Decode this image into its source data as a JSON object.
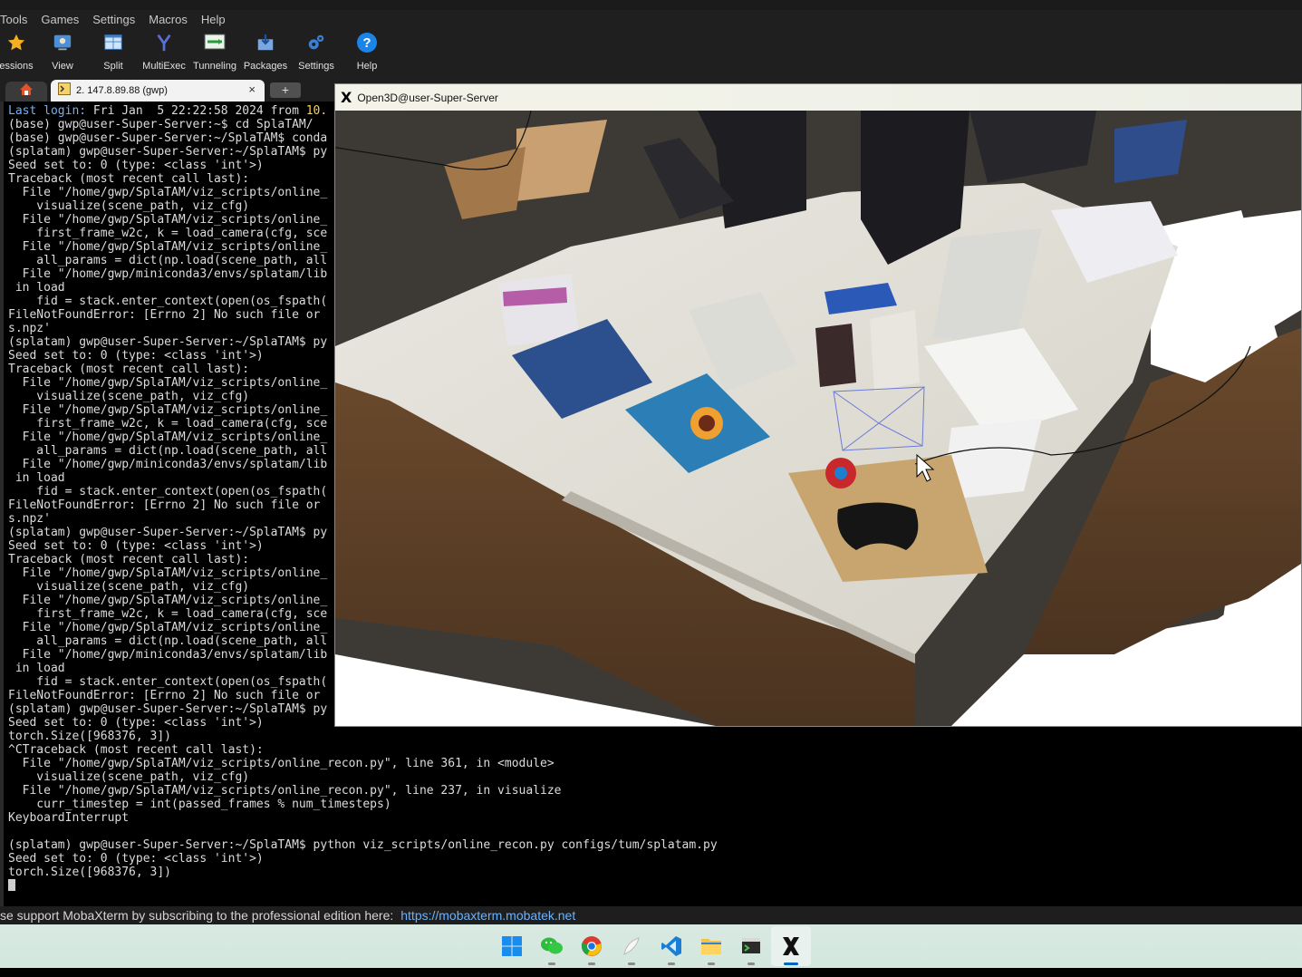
{
  "menubar": {
    "items": [
      "Tools",
      "Games",
      "Settings",
      "Macros",
      "Help"
    ]
  },
  "toolbar": {
    "items": [
      {
        "label": "essions",
        "icon": "star-icon"
      },
      {
        "label": "View",
        "icon": "view-icon"
      },
      {
        "label": "Split",
        "icon": "split-icon"
      },
      {
        "label": "MultiExec",
        "icon": "multiexec-icon"
      },
      {
        "label": "Tunneling",
        "icon": "tunneling-icon"
      },
      {
        "label": "Packages",
        "icon": "packages-icon"
      },
      {
        "label": "Settings",
        "icon": "gears-icon"
      },
      {
        "label": "Help",
        "icon": "help-icon"
      }
    ]
  },
  "tabs": {
    "session_label": "2. 147.8.89.88 (gwp)",
    "close": "×",
    "new_tab": "+"
  },
  "terminal": {
    "lines": [
      [
        "Last login: Fri Jan  5 22:22:58 2024 from 10."
      ],
      [
        "(base) gwp@user-Super-Server:~$ cd SplaTAM/"
      ],
      [
        "(base) gwp@user-Super-Server:~/SplaTAM$ conda"
      ],
      [
        "(splatam) gwp@user-Super-Server:~/SplaTAM$ py"
      ],
      [
        "Seed set to: 0 (type: <class 'int'>)"
      ],
      [
        "Traceback (most recent call last):"
      ],
      [
        "  File \"/home/gwp/SplaTAM/viz_scripts/online_"
      ],
      [
        "    visualize(scene_path, viz_cfg)"
      ],
      [
        "  File \"/home/gwp/SplaTAM/viz_scripts/online_"
      ],
      [
        "    first_frame_w2c, k = load_camera(cfg, sce"
      ],
      [
        "  File \"/home/gwp/SplaTAM/viz_scripts/online_"
      ],
      [
        "    all_params = dict(np.load(scene_path, all"
      ],
      [
        "  File \"/home/gwp/miniconda3/envs/splatam/lib"
      ],
      [
        " in load"
      ],
      [
        "    fid = stack.enter_context(open(os_fspath("
      ],
      [
        "FileNotFoundError: [Errno 2] No such file or"
      ],
      [
        "s.npz'"
      ],
      [
        "(splatam) gwp@user-Super-Server:~/SplaTAM$ py"
      ],
      [
        "Seed set to: 0 (type: <class 'int'>)"
      ],
      [
        "Traceback (most recent call last):"
      ],
      [
        "  File \"/home/gwp/SplaTAM/viz_scripts/online_"
      ],
      [
        "    visualize(scene_path, viz_cfg)"
      ],
      [
        "  File \"/home/gwp/SplaTAM/viz_scripts/online_"
      ],
      [
        "    first_frame_w2c, k = load_camera(cfg, sce"
      ],
      [
        "  File \"/home/gwp/SplaTAM/viz_scripts/online_"
      ],
      [
        "    all_params = dict(np.load(scene_path, all"
      ],
      [
        "  File \"/home/gwp/miniconda3/envs/splatam/lib"
      ],
      [
        " in load"
      ],
      [
        "    fid = stack.enter_context(open(os_fspath("
      ],
      [
        "FileNotFoundError: [Errno 2] No such file or"
      ],
      [
        "s.npz'"
      ],
      [
        "(splatam) gwp@user-Super-Server:~/SplaTAM$ py"
      ],
      [
        "Seed set to: 0 (type: <class 'int'>)"
      ],
      [
        "Traceback (most recent call last):"
      ],
      [
        "  File \"/home/gwp/SplaTAM/viz_scripts/online_"
      ],
      [
        "    visualize(scene_path, viz_cfg)"
      ],
      [
        "  File \"/home/gwp/SplaTAM/viz_scripts/online_"
      ],
      [
        "    first_frame_w2c, k = load_camera(cfg, sce"
      ],
      [
        "  File \"/home/gwp/SplaTAM/viz_scripts/online_"
      ],
      [
        "    all_params = dict(np.load(scene_path, all"
      ],
      [
        "  File \"/home/gwp/miniconda3/envs/splatam/lib"
      ],
      [
        " in load"
      ],
      [
        "    fid = stack.enter_context(open(os_fspath("
      ],
      [
        "FileNotFoundError: [Errno 2] No such file or"
      ],
      [
        "(splatam) gwp@user-Super-Server:~/SplaTAM$ py"
      ],
      [
        "Seed set to: 0 (type: <class 'int'>)"
      ],
      [
        "torch.Size([968376, 3])"
      ],
      [
        "^CTraceback (most recent call last):"
      ],
      [
        "  File \"/home/gwp/SplaTAM/viz_scripts/online_recon.py\", line 361, in <module>"
      ],
      [
        "    visualize(scene_path, viz_cfg)"
      ],
      [
        "  File \"/home/gwp/SplaTAM/viz_scripts/online_recon.py\", line 237, in visualize"
      ],
      [
        "    curr_timestep = int(passed_frames % num_timesteps)"
      ],
      [
        "KeyboardInterrupt"
      ],
      [
        ""
      ],
      [
        "(splatam) gwp@user-Super-Server:~/SplaTAM$ python viz_scripts/online_recon.py configs/tum/splatam.py"
      ],
      [
        "Seed set to: 0 (type: <class 'int'>)"
      ],
      [
        "torch.Size([968376, 3])"
      ]
    ],
    "first_line_parts": [
      "Last login:",
      " Fri Jan  5 22:22:58 2024 from ",
      "10."
    ]
  },
  "open3d": {
    "title": "Open3D@user-Super-Server",
    "logo": "X"
  },
  "statusbar": {
    "text": "se support MobaXterm by subscribing to the professional edition here:",
    "link": "https://mobaxterm.mobatek.net"
  },
  "taskbar": {
    "icons": [
      "windows-start-icon",
      "wechat-icon",
      "chrome-icon",
      "feather-app-icon",
      "vscode-icon",
      "file-explorer-icon",
      "mobaxterm-icon",
      "xserver-icon"
    ]
  },
  "colors": {
    "terminal_bg": "#000000",
    "terminal_fg": "#dcdcdc",
    "login_highlight": "#6fb0ff",
    "ip_highlight": "#ffd24a",
    "link": "#6ab1ff",
    "taskbar_active": "#0067c0"
  }
}
